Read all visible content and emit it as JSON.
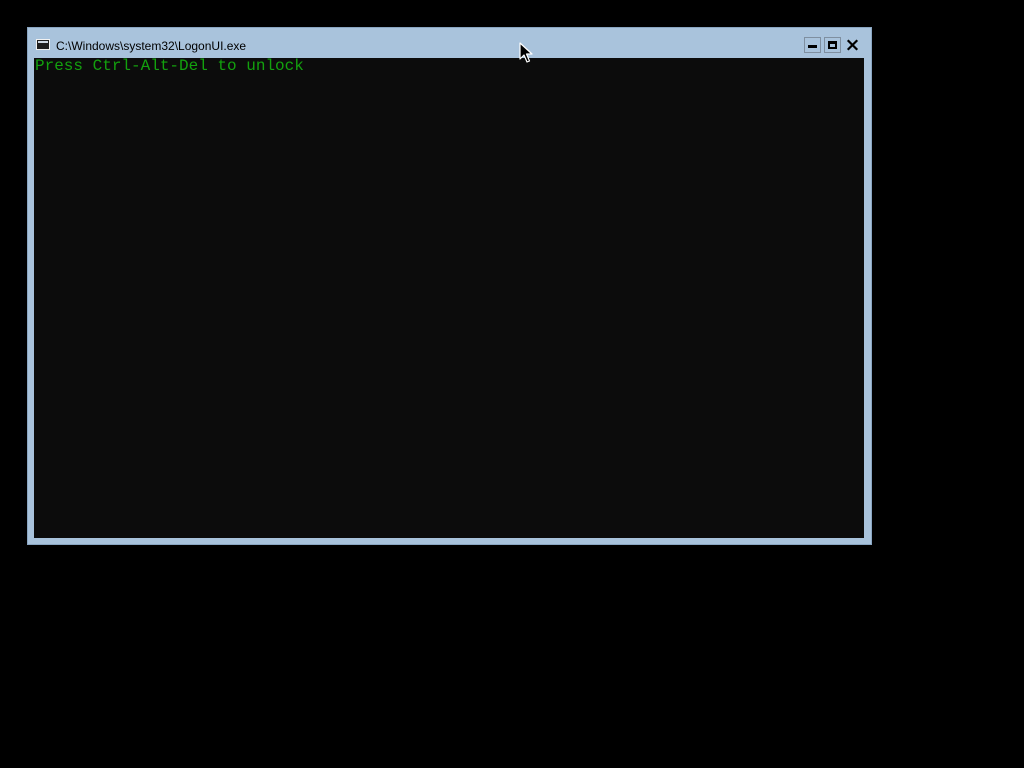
{
  "window": {
    "title": "C:\\Windows\\system32\\LogonUI.exe",
    "controls": {
      "minimize_icon": "minimize-icon",
      "maximize_icon": "maximize-icon",
      "close_icon": "close-icon"
    }
  },
  "console": {
    "lines": [
      "Press Ctrl-Alt-Del to unlock"
    ]
  },
  "colors": {
    "desktop": "#000000",
    "window_frame": "#a9c3dc",
    "console_bg": "#0c0c0c",
    "console_text": "#13a10e"
  }
}
